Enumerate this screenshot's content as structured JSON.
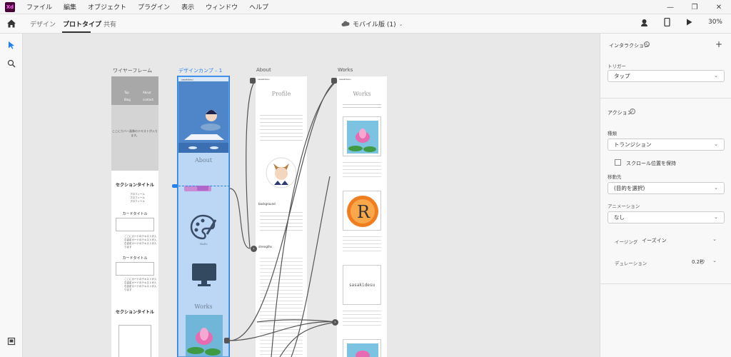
{
  "app": {
    "logo": "Xd",
    "menu": [
      "ファイル",
      "編集",
      "オブジェクト",
      "プラグイン",
      "表示",
      "ウィンドウ",
      "ヘルプ"
    ]
  },
  "toolbar": {
    "tabs": [
      "デザイン",
      "プロトタイプ",
      "共有"
    ],
    "active_tab": "プロトタイプ",
    "doc_title": "モバイル版 (1)",
    "zoom": "30%"
  },
  "canvas": {
    "artboards": {
      "wireframe": {
        "label": "ワイヤーフレーム",
        "nav": [
          "Top",
          "About",
          "Blog",
          "contact"
        ],
        "hero_text": "ここにカバー画像のテキストが入ります。",
        "section_title_1": "セクションタイトル",
        "profile_lines": [
          "プロフィール",
          "プロフィール",
          "プロフィール"
        ],
        "card_title": "カードタイトル",
        "card_text": [
          "ここにカードのテキストが入ります",
          "ここにカードのテキストが入ります",
          "ここにカードのテキストが入ります"
        ],
        "section_title_2": "セクションタイトル"
      },
      "design": {
        "label": "デザインカンプ – 1",
        "about": "About",
        "skills": "Skills",
        "works": "Works"
      },
      "about": {
        "label": "About",
        "heading": "Profile",
        "site": "sasakidesu",
        "background": "background",
        "strengths": "strengths"
      },
      "works": {
        "label": "Works",
        "heading": "Works",
        "site": "sasakidesu",
        "thumb_text": "sasakidesu"
      }
    }
  },
  "panel": {
    "interaction_title": "インタラクション",
    "trigger_label": "トリガー",
    "trigger_value": "タップ",
    "action_title": "アクション",
    "type_label": "種類",
    "type_value": "トランジション",
    "preserve_scroll": "スクロール位置を保持",
    "destination_label": "移動先",
    "destination_value": "(目的を選択)",
    "animation_label": "アニメーション",
    "animation_value": "なし",
    "easing_label": "イージング",
    "easing_value": "イーズイン",
    "duration_label": "デュレーション",
    "duration_value": "0.2秒"
  },
  "colors": {
    "accent": "#2680eb",
    "selection_fill": "#bcd7f5",
    "app_logo_bg": "#470137",
    "app_logo_fg": "#ff61f6"
  }
}
